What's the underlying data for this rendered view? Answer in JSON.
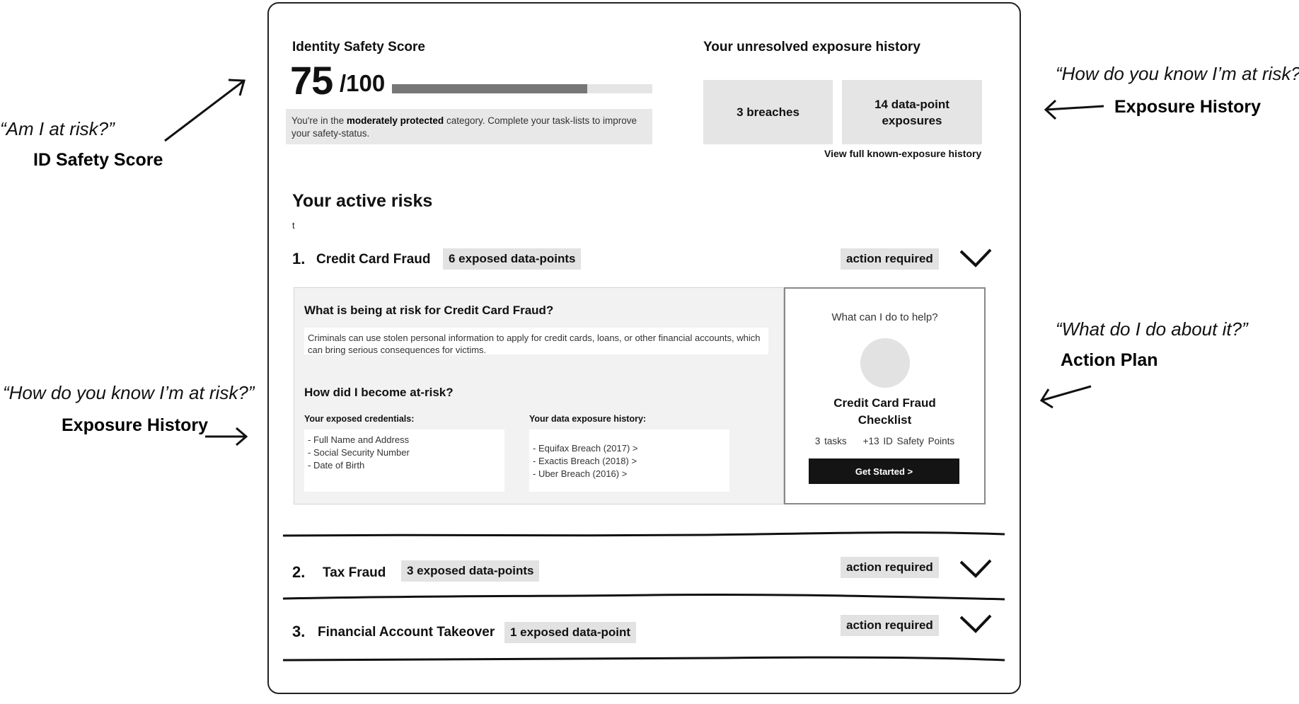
{
  "annotations": {
    "left_top_quote": "“Am I at risk?”",
    "left_top_tag": "ID Safety Score",
    "left_bottom_quote": "“How do you know I’m at risk?”",
    "left_bottom_tag": "Exposure History",
    "right_top_quote": "“How do you know I’m at risk?”",
    "right_top_tag": "Exposure History",
    "right_bottom_quote": "“What do I do about it?”",
    "right_bottom_tag": "Action Plan"
  },
  "score": {
    "title": "Identity Safety Score",
    "value": "75",
    "max": "/100",
    "progress_fraction": 0.75,
    "desc_prefix": "You're in the ",
    "desc_bold": "moderately protected",
    "desc_suffix": " category. Complete your task-lists to improve your safety-status."
  },
  "exposure": {
    "title": "Your unresolved exposure history",
    "breaches": "3 breaches",
    "datapoints_line1": "14 data-point",
    "datapoints_line2": "exposures",
    "link": "View full known-exposure history"
  },
  "risks": {
    "title": "Your active risks",
    "stray_char": "t",
    "items": [
      {
        "num": "1.",
        "name": "Credit Card Fraud",
        "badge": "6 exposed data-points",
        "status": "action required"
      },
      {
        "num": "2.",
        "name": "Tax Fraud",
        "badge": "3 exposed data-points",
        "status": "action required"
      },
      {
        "num": "3.",
        "name": "Financial Account Takeover",
        "badge": "1 exposed data-point",
        "status": "action required"
      }
    ]
  },
  "detail": {
    "heading1": "What is being at risk for Credit Card Fraud?",
    "text1": "Criminals can use stolen personal information to apply for credit cards, loans, or other financial accounts, which can bring serious consequences for victims.",
    "heading2": "How did I become at-risk?",
    "creds_label": "Your exposed credentials:",
    "creds": [
      "- Full Name and Address",
      "- Social Security Number",
      "- Date of Birth"
    ],
    "history_label": "Your data exposure history:",
    "history": [
      "- Equifax Breach (2017) >",
      "- Exactis Breach (2018) >",
      "- Uber Breach (2016) >"
    ]
  },
  "action_plan": {
    "question": "What can I do to help?",
    "title_line1": "Credit Card Fraud",
    "title_line2": "Checklist",
    "tasks": "3 tasks",
    "points": "+13 ID Safety Points",
    "button": "Get Started >"
  },
  "colors": {
    "progress_fill": "#777777",
    "progress_track": "#e5e5e5",
    "button_bg": "#141414",
    "badge_bg": "#e2e2e2"
  }
}
